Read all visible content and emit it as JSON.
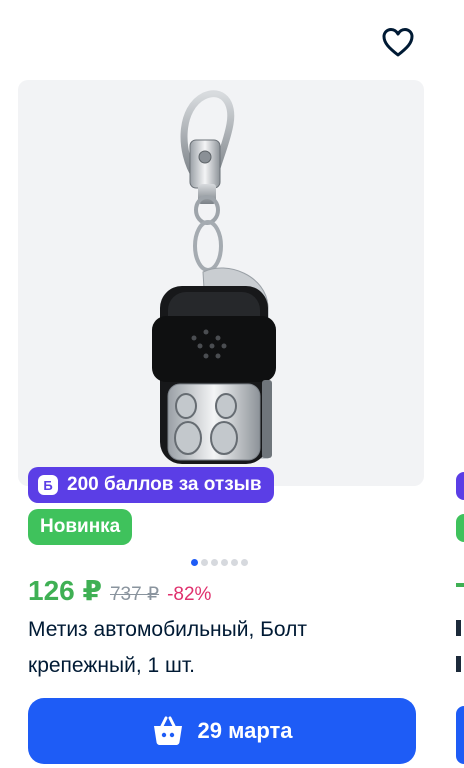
{
  "product": {
    "bonus_badge": {
      "icon_letter": "Б",
      "text": "200 баллов за отзыв",
      "color": "#5b3ee6"
    },
    "new_badge": {
      "text": "Новинка",
      "color": "#3fc25c"
    },
    "image_dots": {
      "count": 6,
      "active_index": 0
    },
    "price": {
      "current": "126 ₽",
      "old": "737 ₽",
      "discount": "-82%"
    },
    "title": "Метиз автомобильный, Болт крепежный, 1 шт.",
    "cart_button": {
      "icon": "basket-icon",
      "label": "29 марта",
      "color": "#1e5cf6"
    },
    "favorite_icon": "heart-outline-icon",
    "image_icon": "key-fob-remote-image"
  },
  "colors": {
    "accent": "#1e5cf6",
    "price_green": "#3fb054",
    "discount": "#e0306d",
    "old_price": "#8a949e"
  }
}
